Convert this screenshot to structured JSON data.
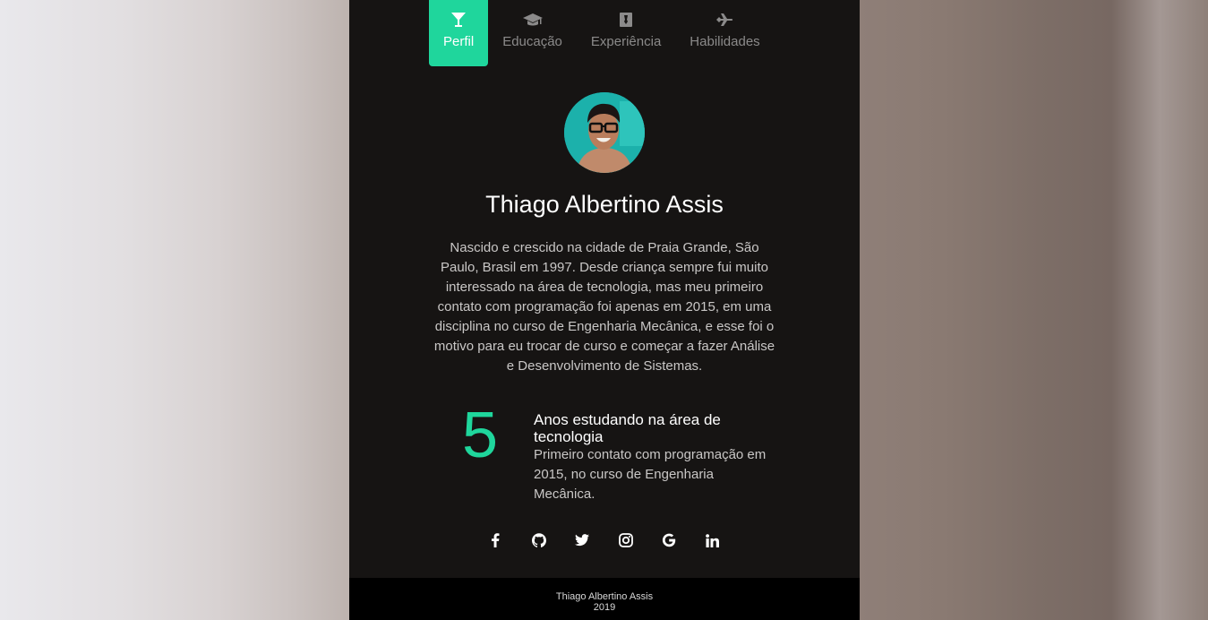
{
  "tabs": [
    {
      "label": "Perfil",
      "icon": "cocktail-icon",
      "active": true
    },
    {
      "label": "Educação",
      "icon": "graduation-cap-icon",
      "active": false
    },
    {
      "label": "Experiência",
      "icon": "briefcase-icon",
      "active": false
    },
    {
      "label": "Habilidades",
      "icon": "plane-icon",
      "active": false
    }
  ],
  "profile": {
    "name": "Thiago Albertino Assis",
    "bio": "Nascido e crescido na cidade de Praia Grande, São Paulo, Brasil em 1997. Desde criança sempre fui muito interessado na área de tecnologia, mas meu primeiro contato com programação foi apenas em 2015, em uma disciplina no curso de Engenharia Mecânica, e esse foi o motivo para eu trocar de curso e começar a fazer Análise e Desenvolvimento de Sistemas."
  },
  "stat": {
    "number": "5",
    "title": "Anos estudando na área de tecnologia",
    "description": "Primeiro contato com programação em 2015, no curso de Engenharia Mecânica."
  },
  "socials": [
    "facebook-icon",
    "github-icon",
    "twitter-icon",
    "instagram-icon",
    "google-icon",
    "linkedin-icon"
  ],
  "footer": {
    "name": "Thiago Albertino Assis",
    "year": "2019"
  },
  "colors": {
    "accent": "#1fd69c",
    "card_background": "#161413",
    "footer_background": "#000000"
  }
}
